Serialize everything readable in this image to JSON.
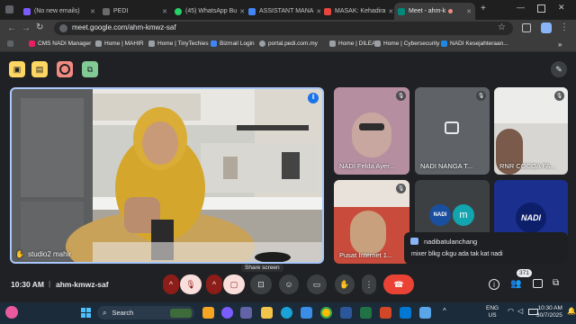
{
  "browser": {
    "tabs": [
      {
        "label": "(No new emails)",
        "color": "#7b5cff"
      },
      {
        "label": "PEDI",
        "color": "#6b6b6b"
      },
      {
        "label": "(45) WhatsApp Bu",
        "color": "#25d366"
      },
      {
        "label": "ASSISTANT MANA",
        "color": "#4285f4"
      },
      {
        "label": "MASAK: Kehadira",
        "color": "#e8453c"
      },
      {
        "label": "Meet - ahm-k",
        "color": "#00897b"
      }
    ],
    "url": "meet.google.com/ahm-kmwz-saf",
    "bookmarks": [
      "CMS NADI Manager",
      "Home | MAHIR",
      "Home | TinyTechies",
      "Bizmail Login",
      "portal.pedi.com.my",
      "Home | DILEA",
      "Home | Cybersecurity",
      "NADI Kesejahteraan..."
    ]
  },
  "meet": {
    "top_buttons": [
      {
        "icon": "activities-icon",
        "color": "#fdd663"
      },
      {
        "icon": "whiteboard-icon",
        "color": "#fdd663"
      },
      {
        "icon": "record-icon",
        "color": "#f28b82"
      },
      {
        "icon": "breakout-icon",
        "color": "#81c995"
      }
    ],
    "main_speaker": "studio2 mahir",
    "tiles": [
      {
        "name": "NADI Felda Ayer..."
      },
      {
        "name": "NADI NANGA T..."
      },
      {
        "name": "RNR COCOA FA..."
      },
      {
        "name": "Pusat Internet 1..."
      },
      {
        "name": "NADI"
      },
      {
        "name": "NADI"
      }
    ],
    "tile_avatar_letter": "m",
    "tooltip": "Share screen",
    "chat": {
      "sender": "nadibatulanchang",
      "message": "mixer blkg cikgu ada tak kat nadi"
    },
    "people_count": "371",
    "time": "10:30 AM",
    "meeting_code": "ahm-kmwz-saf"
  },
  "taskbar": {
    "search_label": "Search",
    "lang": "ENG",
    "lang_region": "US",
    "clock_time": "10:30 AM",
    "clock_date": "30/7/2025"
  }
}
